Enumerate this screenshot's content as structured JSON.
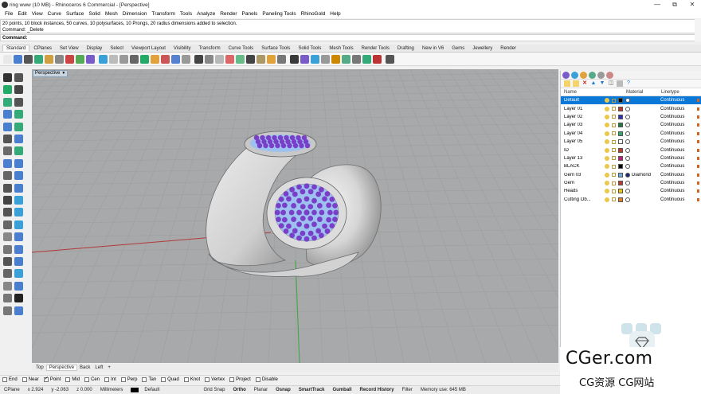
{
  "window": {
    "title": "ring www (10 MB) - Rhinoceros 6 Commercial - [Perspective]",
    "controls": [
      "—",
      "⧉",
      "✕"
    ]
  },
  "menu": [
    "File",
    "Edit",
    "View",
    "Curve",
    "Surface",
    "Solid",
    "Mesh",
    "Dimension",
    "Transform",
    "Tools",
    "Analyze",
    "Render",
    "Panels",
    "Paneling Tools",
    "RhinoGold",
    "Help"
  ],
  "command": {
    "history_line1": "20 points, 10 block instances, 50 curves, 10 polysurfaces, 10 Prongs, 20 radius dimensions added to selection.",
    "history_line2": "Command: _Delete",
    "prompt": "Command:"
  },
  "toolbar_tabs": [
    "Standard",
    "CPlanes",
    "Set View",
    "Display",
    "Select",
    "Viewport Layout",
    "Visibility",
    "Transform",
    "Curve Tools",
    "Surface Tools",
    "Solid Tools",
    "Mesh Tools",
    "Render Tools",
    "Drafting",
    "New in V6",
    "Gems",
    "Jewellery",
    "Render"
  ],
  "active_tab": "Standard",
  "viewport": {
    "label": "Perspective",
    "tabs": [
      "Top",
      "Perspective",
      "Back",
      "Left",
      "+"
    ],
    "active": "Perspective",
    "colors": {
      "background": "#a7a9ab",
      "grid": "#9c9ea0",
      "x_axis": "#b33a3a",
      "y_axis": "#3aa83a",
      "gem": "#7a3fc9",
      "seat": "#9ec2f0"
    }
  },
  "osnaps": [
    {
      "label": "End",
      "on": false
    },
    {
      "label": "Near",
      "on": false
    },
    {
      "label": "Point",
      "on": true
    },
    {
      "label": "Mid",
      "on": false
    },
    {
      "label": "Cen",
      "on": false
    },
    {
      "label": "Int",
      "on": false
    },
    {
      "label": "Perp",
      "on": false
    },
    {
      "label": "Tan",
      "on": false
    },
    {
      "label": "Quad",
      "on": false
    },
    {
      "label": "Knot",
      "on": false
    },
    {
      "label": "Vertex",
      "on": false
    },
    {
      "label": "Project",
      "on": false
    },
    {
      "label": "Disable",
      "on": false
    }
  ],
  "status": {
    "cplane": "CPlane",
    "x": "x 2.924",
    "y": "y -2.063",
    "z": "z 0.000",
    "units": "Millimeters",
    "layer": "Default",
    "items": [
      {
        "label": "Grid Snap",
        "bold": false
      },
      {
        "label": "Ortho",
        "bold": true
      },
      {
        "label": "Planar",
        "bold": false
      },
      {
        "label": "Osnap",
        "bold": true
      },
      {
        "label": "SmartTrack",
        "bold": true
      },
      {
        "label": "Gumball",
        "bold": true
      },
      {
        "label": "Record History",
        "bold": true
      },
      {
        "label": "Filter",
        "bold": false
      }
    ],
    "memory": "Memory use: 645 MB"
  },
  "layers": {
    "headers": {
      "name": "Name",
      "material": "Material",
      "linetype": "Linetype"
    },
    "rows": [
      {
        "name": "Default",
        "color": "#000000",
        "material": "",
        "linetype": "Continuous",
        "selected": true
      },
      {
        "name": "Layer 01",
        "color": "#c0392b",
        "material": "",
        "linetype": "Continuous",
        "selected": false
      },
      {
        "name": "Layer 02",
        "color": "#2f2fb8",
        "material": "",
        "linetype": "Continuous",
        "selected": false
      },
      {
        "name": "Layer 03",
        "color": "#1b7f3a",
        "material": "",
        "linetype": "Continuous",
        "selected": false
      },
      {
        "name": "Layer 04",
        "color": "#27ae60",
        "material": "",
        "linetype": "Continuous",
        "selected": false
      },
      {
        "name": "Layer 05",
        "color": "#ffffff",
        "material": "",
        "linetype": "Continuous",
        "selected": false
      },
      {
        "name": "ID",
        "color": "#c0392b",
        "material": "",
        "linetype": "Continuous",
        "selected": false
      },
      {
        "name": "Layer 13",
        "color": "#c2187a",
        "material": "",
        "linetype": "Continuous",
        "selected": false
      },
      {
        "name": "BLACK",
        "color": "#000000",
        "material": "",
        "linetype": "Continuous",
        "selected": false
      },
      {
        "name": "Gem 03",
        "color": "#6fa8dc",
        "material": "Diamond",
        "linetype": "Continuous",
        "selected": false
      },
      {
        "name": "Gem",
        "color": "#c0392b",
        "material": "",
        "linetype": "Continuous",
        "selected": false
      },
      {
        "name": "Heads",
        "color": "#f1c40f",
        "material": "",
        "linetype": "Continuous",
        "selected": false
      },
      {
        "name": "Cutting Ob...",
        "color": "#e67e22",
        "material": "",
        "linetype": "Continuous",
        "selected": false
      }
    ]
  },
  "watermark": {
    "main": "CGer.com",
    "sub": "CG资源 CG网站"
  }
}
